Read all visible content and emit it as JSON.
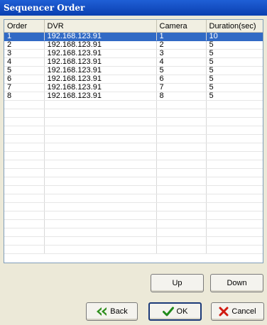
{
  "window": {
    "title": "Sequencer Order"
  },
  "table": {
    "columns": [
      "Order",
      "DVR",
      "Camera",
      "Duration(sec)"
    ],
    "rows": [
      [
        "1",
        "192.168.123.91",
        "1",
        "10"
      ],
      [
        "2",
        "192.168.123.91",
        "2",
        "5"
      ],
      [
        "3",
        "192.168.123.91",
        "3",
        "5"
      ],
      [
        "4",
        "192.168.123.91",
        "4",
        "5"
      ],
      [
        "5",
        "192.168.123.91",
        "5",
        "5"
      ],
      [
        "6",
        "192.168.123.91",
        "6",
        "5"
      ],
      [
        "7",
        "192.168.123.91",
        "7",
        "5"
      ],
      [
        "8",
        "192.168.123.91",
        "8",
        "5"
      ]
    ],
    "selected_row": 0
  },
  "buttons": {
    "up": "Up",
    "down": "Down",
    "back": "Back",
    "ok": "OK",
    "cancel": "Cancel"
  },
  "icons": {
    "back": "double-chevron-left-icon",
    "ok": "checkmark-icon",
    "cancel": "x-icon"
  },
  "colors": {
    "selection": "#316ac5",
    "back_icon": "#2f8f1e",
    "ok_icon": "#1f8a1a",
    "cancel_icon": "#d11a0f"
  }
}
